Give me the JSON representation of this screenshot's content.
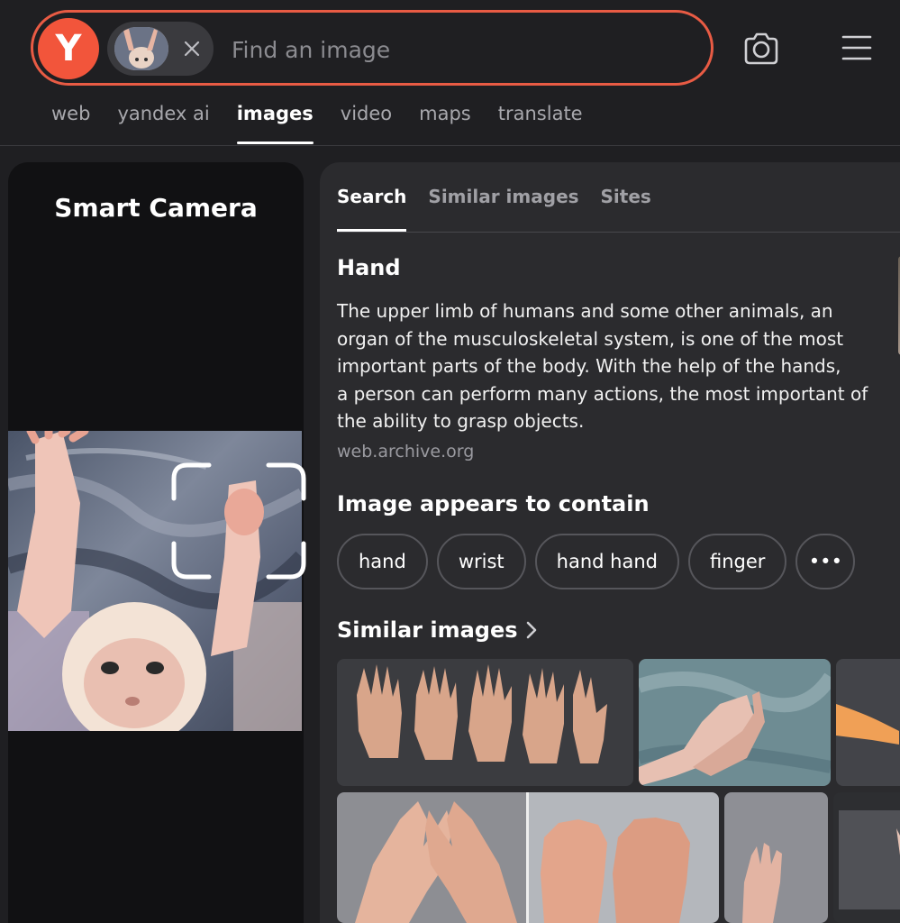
{
  "search": {
    "placeholder": "Find an image",
    "logo_letter": "Y"
  },
  "nav": {
    "items": [
      {
        "label": "web",
        "active": false
      },
      {
        "label": "yandex ai",
        "active": false
      },
      {
        "label": "images",
        "active": true
      },
      {
        "label": "video",
        "active": false
      },
      {
        "label": "maps",
        "active": false
      },
      {
        "label": "translate",
        "active": false
      }
    ]
  },
  "left_panel": {
    "title": "Smart Camera"
  },
  "tabs": [
    {
      "label": "Search",
      "active": true
    },
    {
      "label": "Similar images",
      "active": false
    },
    {
      "label": "Sites",
      "active": false
    }
  ],
  "entity": {
    "title": "Hand",
    "description_lines": [
      "The upper limb of humans and some other animals, an",
      "organ of the musculoskeletal system, is one of the most",
      "important parts of the body. With the help of the hands,",
      "a person can perform many actions, the most important of",
      "the ability to grasp objects."
    ],
    "source": "web.archive.org"
  },
  "contains": {
    "title": "Image appears to contain",
    "chips": [
      "hand",
      "wrist",
      "hand hand",
      "finger"
    ],
    "more_label": "•••"
  },
  "similar": {
    "title": "Similar images"
  },
  "colors": {
    "accent": "#e85b44",
    "logo": "#f2553b",
    "background": "#1f1f22",
    "panel": "#2b2b2e"
  }
}
